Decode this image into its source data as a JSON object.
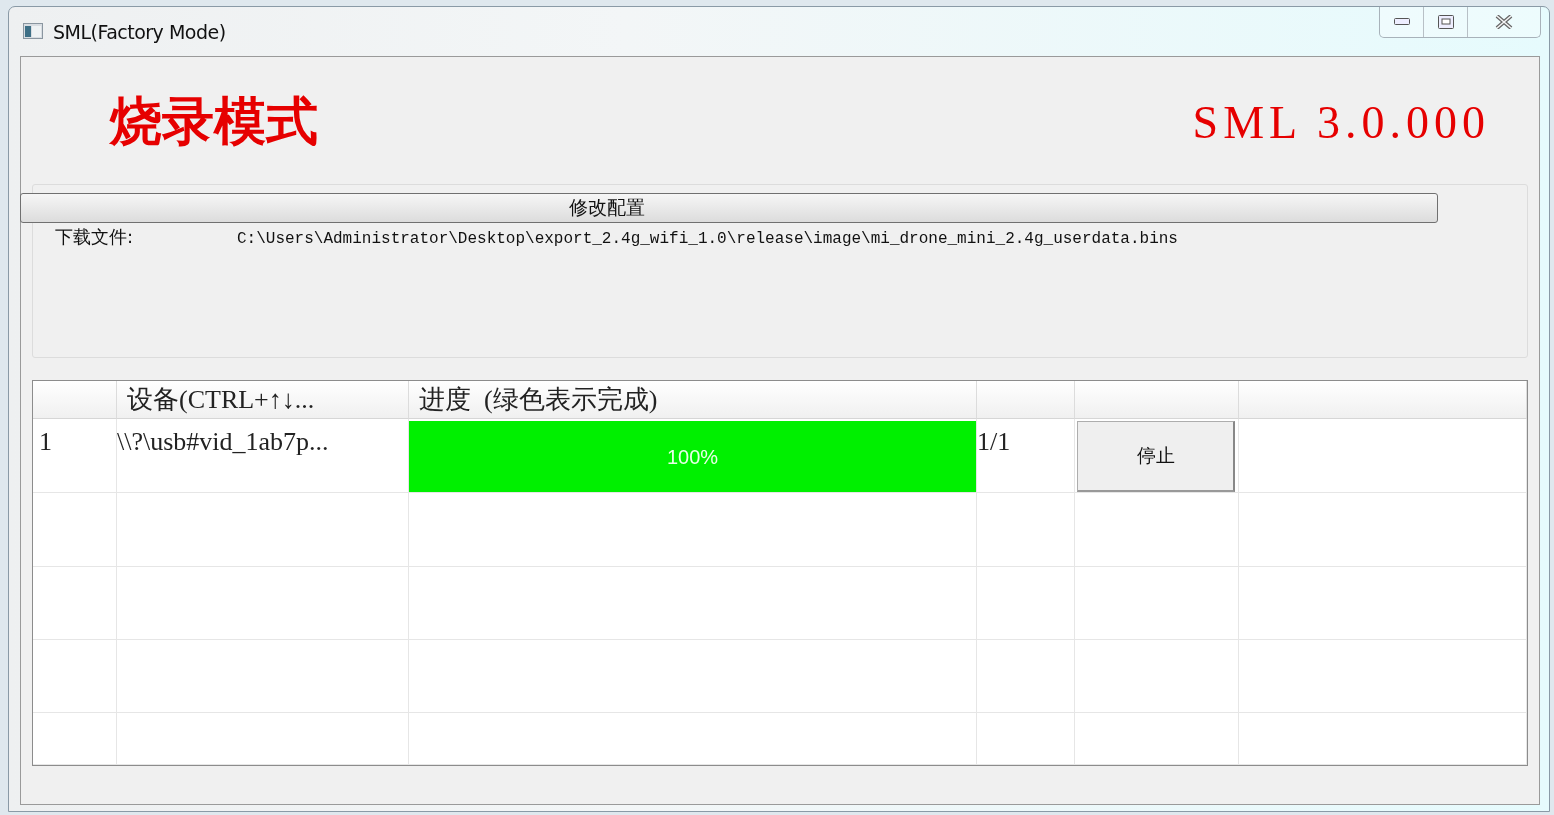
{
  "window": {
    "title": "SML(Factory Mode)"
  },
  "header": {
    "mode_title": "烧录模式",
    "version": "SML 3.0.000"
  },
  "config": {
    "button": "修改配置",
    "download_label": "下载文件:",
    "download_path": "C:\\Users\\Administrator\\Desktop\\export_2.4g_wifi_1.0\\release\\image\\mi_drone_mini_2.4g_userdata.bins"
  },
  "table": {
    "device_header": "设备(CTRL+↑↓...",
    "progress_header": "进度  (绿色表示完成)",
    "rows": [
      {
        "index": "1",
        "device": "\\\\?\\usb#vid_1ab7p...",
        "level": 1,
        "progress_text": "100%",
        "count": "1/1",
        "action": "停止"
      }
    ]
  }
}
